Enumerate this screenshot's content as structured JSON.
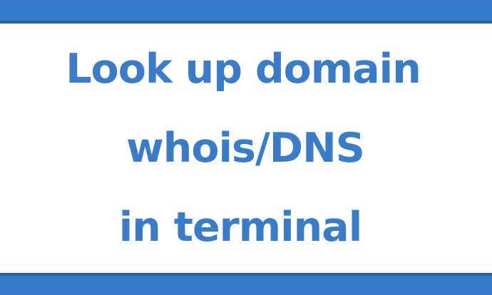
{
  "title_lines": [
    "Look up domain",
    "whois/DNS",
    "in terminal"
  ],
  "colors": {
    "accent": "#357ac6",
    "accent_dark": "#2a63a6",
    "text": "#3a7cc7",
    "background": "#ffffff"
  }
}
